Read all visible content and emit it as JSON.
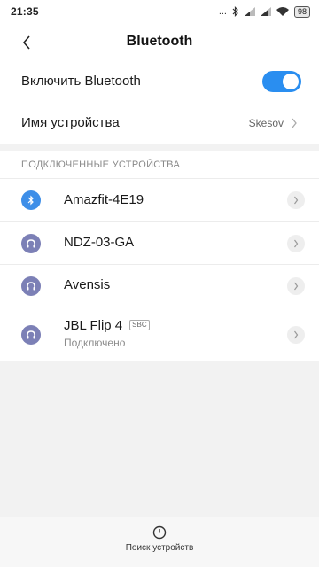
{
  "status_bar": {
    "time": "21:35",
    "dots": "...",
    "battery": "98"
  },
  "header": {
    "title": "Bluetooth"
  },
  "settings": {
    "bluetooth_toggle_label": "Включить Bluetooth",
    "bluetooth_enabled": true,
    "device_name_label": "Имя устройства",
    "device_name_value": "Skesov"
  },
  "connected": {
    "section_title": "ПОДКЛЮЧЕННЫЕ УСТРОЙСТВА",
    "devices": [
      {
        "name": "Amazfit-4E19",
        "icon": "bluetooth-icon"
      },
      {
        "name": "NDZ-03-GA",
        "icon": "headphones-icon"
      },
      {
        "name": "Avensis",
        "icon": "headphones-icon"
      },
      {
        "name": "JBL Flip 4",
        "icon": "headphones-icon",
        "codec": "SBC",
        "status": "Подключено"
      }
    ]
  },
  "bottom": {
    "search_label": "Поиск устройств"
  },
  "colors": {
    "accent": "#2a8ef0",
    "bt_icon_bg": "#3d8ee8",
    "headphones_icon_bg": "#7c80b6"
  }
}
